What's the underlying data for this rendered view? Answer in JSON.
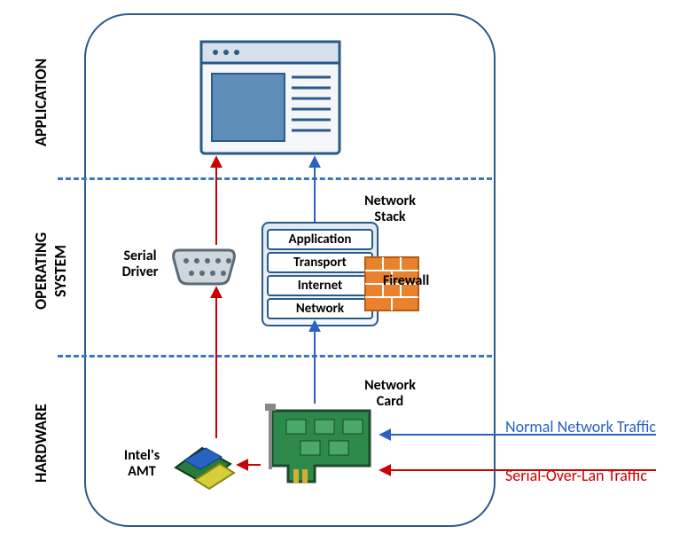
{
  "layers": {
    "application": "APPLICATION",
    "os": "OPERATING\nSYSTEM",
    "hardware": "HARDWARE"
  },
  "labels": {
    "serialDriver": "Serial\nDriver",
    "networkStack": "Network\nStack",
    "firewall": "Firewall",
    "networkCard": "Network\nCard",
    "intelAmt": "Intel's\nAMT"
  },
  "stack": [
    "Application",
    "Transport",
    "Internet",
    "Network"
  ],
  "external": {
    "normal": "Normal Network Traffic",
    "sol": "Serial-Over-Lan Traffic"
  },
  "colors": {
    "normal": "#2a62c4",
    "sol": "#cc0000"
  }
}
